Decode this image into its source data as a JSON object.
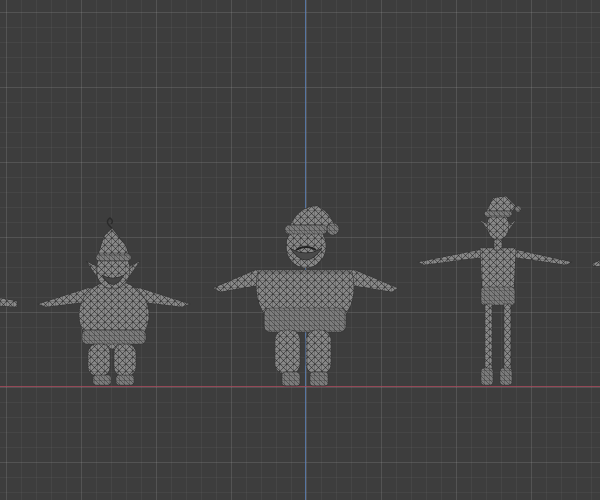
{
  "viewport": {
    "mode": "wireframe-3d-view",
    "colors": {
      "background": "#3d3d3d",
      "grid": "#4a4a4a",
      "z_axis": "#5b7fb4",
      "x_axis": "#a24a5a",
      "mesh_fill": "#858585",
      "mesh_wire": "#2e2e2e"
    }
  },
  "models": [
    {
      "name": "partial-character-left-edge"
    },
    {
      "name": "elf-chubby-bearded"
    },
    {
      "name": "santa-claus"
    },
    {
      "name": "elf-thin"
    },
    {
      "name": "partial-character-right-edge"
    }
  ]
}
